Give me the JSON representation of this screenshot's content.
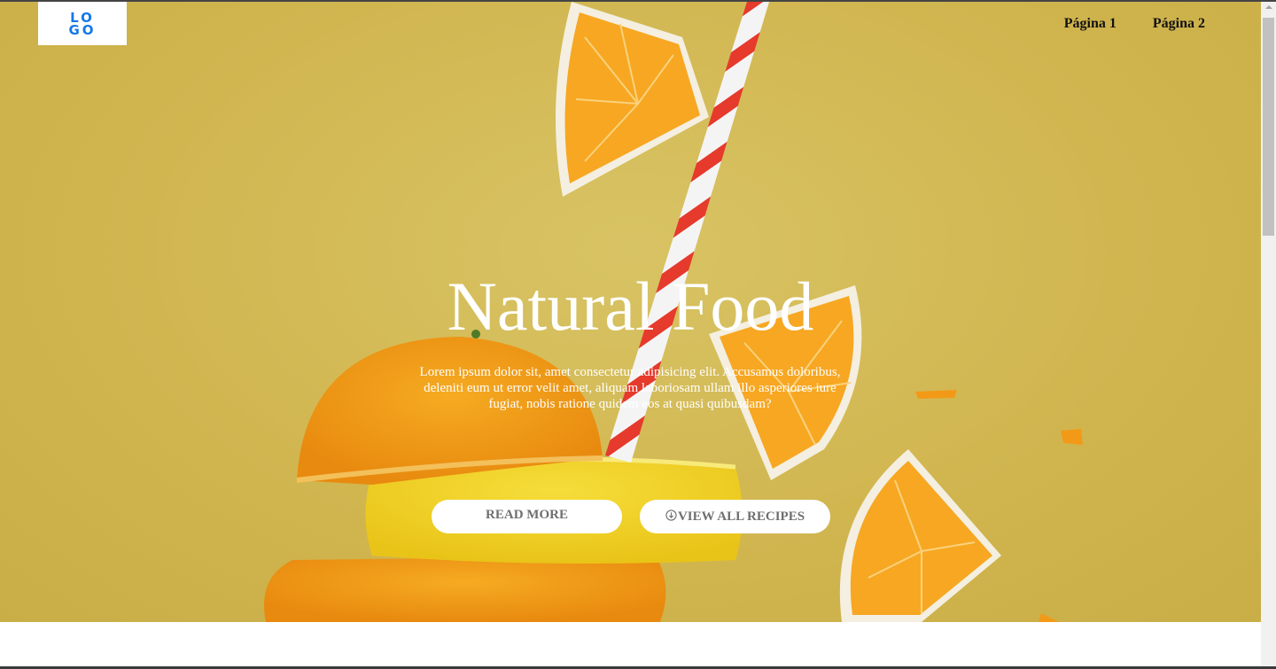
{
  "logo": {
    "text": "LOGO"
  },
  "nav": {
    "items": [
      "Página 1",
      "Página 2"
    ]
  },
  "hero": {
    "title": "Natural Food",
    "description": "Lorem ipsum dolor sit, amet consectetur adipisicing elit. Accusamus doloribus, deleniti eum ut error velit amet, aliquam laboriosam ullam illo asperiores iure fugiat, nobis ratione quidem eos at quasi quibusdam?",
    "buttons": {
      "read_more": "READ MORE",
      "view_all": "VIEW ALL RECIPES"
    }
  },
  "colors": {
    "background": "#d1b650",
    "logo_blue": "#1577e8",
    "orange": "#f29a17",
    "lemon": "#f3d321",
    "straw_red": "#e53a2c",
    "button_text": "#6f6f6f"
  },
  "icons": {
    "view_all_button": "download-circle-icon"
  }
}
